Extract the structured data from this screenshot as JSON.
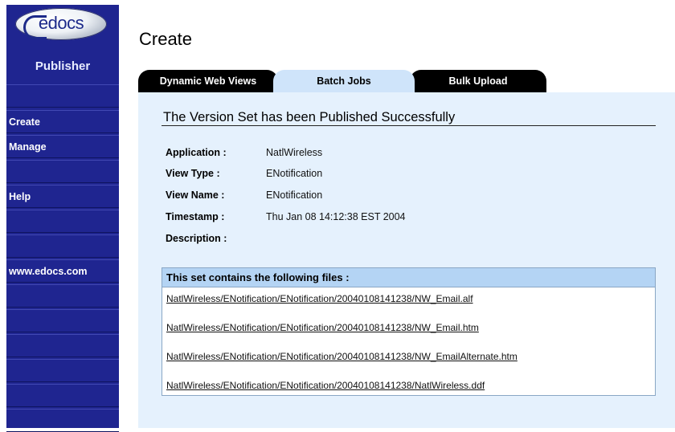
{
  "sidebar": {
    "logo_text": "edocs",
    "product": "Publisher",
    "items": [
      {
        "label": ""
      },
      {
        "label": "Create"
      },
      {
        "label": "Manage"
      },
      {
        "label": ""
      },
      {
        "label": "Help"
      },
      {
        "label": ""
      },
      {
        "label": ""
      },
      {
        "label": "www.edocs.com"
      },
      {
        "label": ""
      },
      {
        "label": ""
      },
      {
        "label": ""
      },
      {
        "label": ""
      },
      {
        "label": ""
      },
      {
        "label": ""
      }
    ]
  },
  "header": {
    "title": "Create"
  },
  "tabs": [
    {
      "label": "Dynamic Web Views",
      "active": false
    },
    {
      "label": "Batch Jobs",
      "active": true
    },
    {
      "label": "Bulk Upload",
      "active": false
    }
  ],
  "result": {
    "heading": "The Version Set has been Published Successfully",
    "fields": [
      {
        "label": "Application :",
        "value": "NatlWireless"
      },
      {
        "label": "View Type :",
        "value": "ENotification"
      },
      {
        "label": "View Name :",
        "value": "ENotification"
      },
      {
        "label": "Timestamp :",
        "value": "Thu Jan 08 14:12:38 EST 2004"
      },
      {
        "label": "Description :",
        "value": ""
      }
    ]
  },
  "files": {
    "header": "This set contains the following files :",
    "items": [
      "NatlWireless/ENotification/ENotification/20040108141238/NW_Email.alf",
      "NatlWireless/ENotification/ENotification/20040108141238/NW_Email.htm",
      "NatlWireless/ENotification/ENotification/20040108141238/NW_EmailAlternate.htm",
      "NatlWireless/ENotification/ENotification/20040108141238/NatlWireless.ddf"
    ]
  },
  "colors": {
    "sidebar": "#1f2590",
    "panel": "#e5f1fd",
    "active_tab": "#cfe4fa",
    "files_header": "#b4d4f4"
  }
}
